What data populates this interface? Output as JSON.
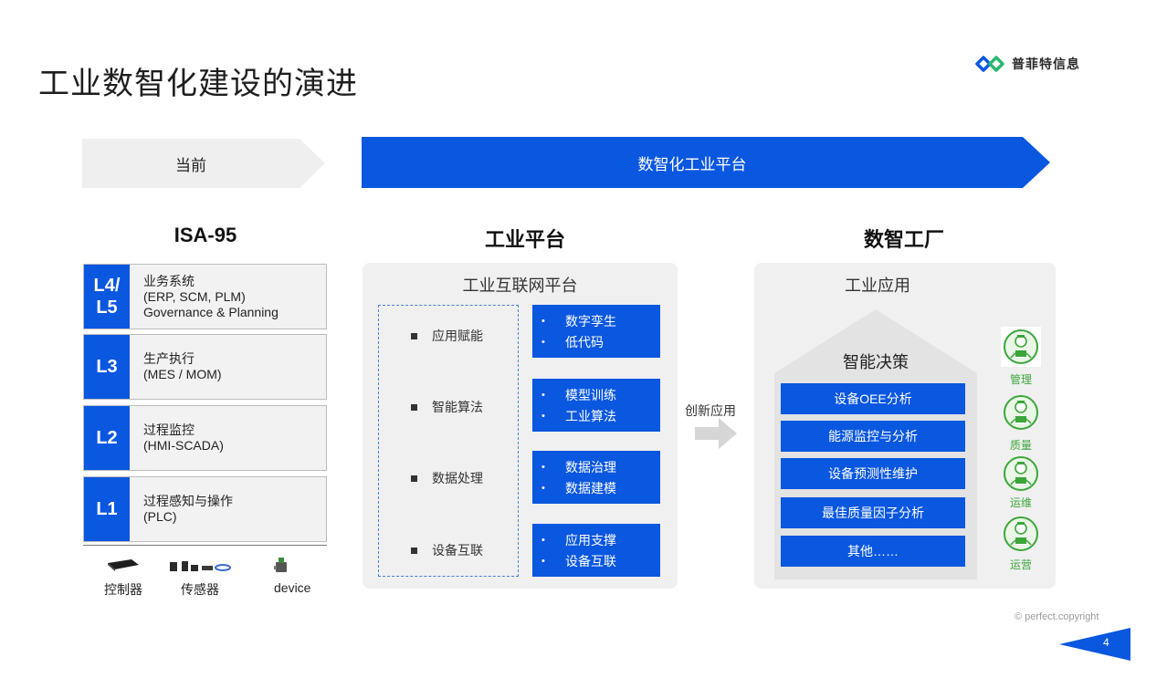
{
  "title": "工业数智化建设的演进",
  "logo": {
    "text": "普菲特信息"
  },
  "arrows": {
    "current": "当前",
    "platform": "数智化工业平台"
  },
  "isa95": {
    "title": "ISA-95",
    "layers": [
      {
        "level": "L4/\nL5",
        "lines": [
          "业务系统",
          "(ERP, SCM, PLM)",
          "Governance & Planning"
        ]
      },
      {
        "level": "L3",
        "lines": [
          "生产执行",
          "(MES / MOM)"
        ]
      },
      {
        "level": "L2",
        "lines": [
          "过程监控",
          "(HMI-SCADA)"
        ]
      },
      {
        "level": "L1",
        "lines": [
          "过程感知与操作",
          "(PLC)"
        ]
      }
    ],
    "devices": [
      "控制器",
      "传感器",
      "device"
    ]
  },
  "platform": {
    "title": "工业平台",
    "panel_title": "工业互联网平台",
    "capabilities": [
      {
        "name": "应用赋能",
        "items": [
          "数字孪生",
          "低代码"
        ]
      },
      {
        "name": "智能算法",
        "items": [
          "模型训练",
          "工业算法"
        ]
      },
      {
        "name": "数据处理",
        "items": [
          "数据治理",
          "数据建模"
        ]
      },
      {
        "name": "设备互联",
        "items": [
          "应用支撑",
          "设备互联"
        ]
      }
    ],
    "bullet": "•"
  },
  "innovation_label": "创新应用",
  "factory": {
    "title": "数智工厂",
    "panel_title": "工业应用",
    "roof_label": "智能决策",
    "apps": [
      "设备OEE分析",
      "能源监控与分析",
      "设备预测性维护",
      "最佳质量因子分析",
      "其他……"
    ],
    "roles": [
      "管理",
      "质量",
      "运维",
      "运营"
    ]
  },
  "footer": {
    "copyright": "© perfect.copyright",
    "page": "4"
  },
  "colors": {
    "blue": "#0a57e0",
    "green": "#3ca63c",
    "panel": "#f0f0f0"
  }
}
